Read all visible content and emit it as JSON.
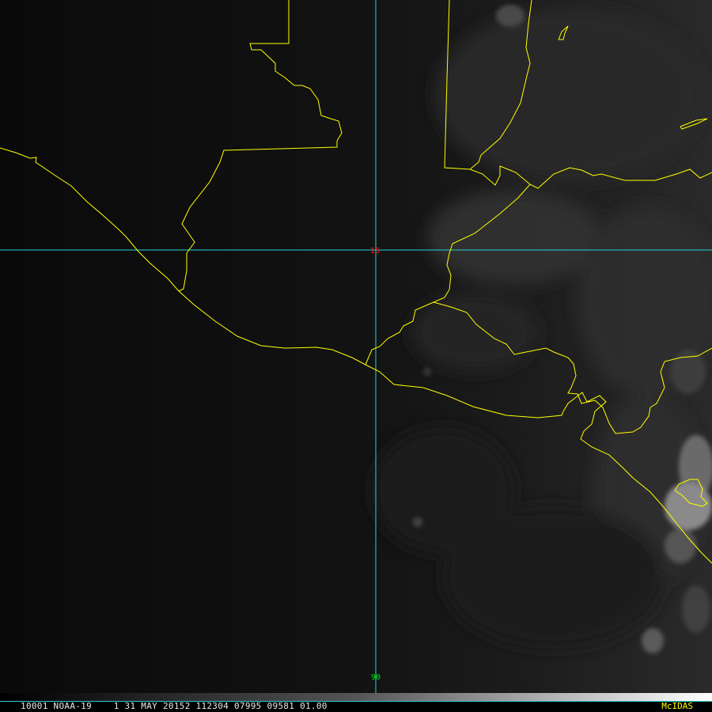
{
  "map": {
    "latitude_label": "15",
    "longitude_label": "90",
    "colors": {
      "background": "#0b0b0b",
      "border": "#ffff00",
      "graticule": "#2ad2d2",
      "latitude_label": "#ff2020",
      "longitude_label": "#00dd00"
    }
  },
  "status_bar": {
    "frame": "1",
    "info": "0001 NOAA-19    1 31 MAY 20152 112304 07995 09581 01.00",
    "brand": "McIDAS"
  }
}
